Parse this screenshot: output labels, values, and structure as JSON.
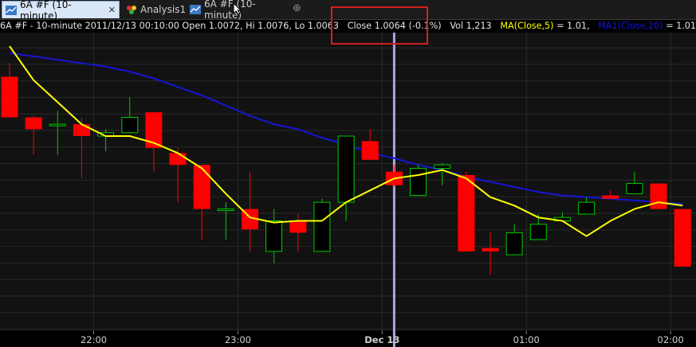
{
  "tabs": [
    {
      "label": "6A #F (10-minute)",
      "icon": "chart-icon",
      "active": true
    },
    {
      "label": "Analysis1",
      "icon": "analysis-icon",
      "active": false
    },
    {
      "label": "6A #F (10-minute)",
      "icon": "chart-icon",
      "active": false
    }
  ],
  "tab_close_symbol": "✕",
  "add_tab_symbol": "⊕",
  "info": {
    "symbol_text": "6A #F - 10-minute 2011/12/13 00:10:00 Open 1.0072, Hi 1.0076, Lo 1.0063",
    "close_text": "Close 1.0064 (-0.1%)",
    "vol_text": "Vol 1,213",
    "ma5_label": "MA(Close,5)",
    "ma5_value": "= 1.01,",
    "ma20_label": "MA1(Close,20)",
    "ma20_value": "= 1.01",
    "ma5_color": "#ffff00",
    "ma20_color": "#1515d6"
  },
  "chart_data": {
    "type": "candlestick",
    "x_tick_labels": [
      "22:00",
      "23:00",
      "Dec 13",
      "01:00",
      "02:00"
    ],
    "x_tick_slots": [
      3.5,
      9.5,
      15.5,
      21.5,
      27.5
    ],
    "crosshair_slot": 16,
    "up_color": "#00cc00",
    "down_color": "#ff0000",
    "ylim": [
      0.9978,
      1.0154
    ],
    "grid": true,
    "candles": [
      {
        "o": 1.0128,
        "h": 1.0136,
        "l": 1.0105,
        "c": 1.0104
      },
      {
        "o": 1.0104,
        "h": 1.0105,
        "l": 1.0082,
        "c": 1.0097
      },
      {
        "o": 1.01,
        "h": 1.0108,
        "l": 1.0082,
        "c": 1.01
      },
      {
        "o": 1.01,
        "h": 1.0104,
        "l": 1.0068,
        "c": 1.0093
      },
      {
        "o": 1.0093,
        "h": 1.0097,
        "l": 1.0084,
        "c": 1.0095
      },
      {
        "o": 1.0095,
        "h": 1.0116,
        "l": 1.0095,
        "c": 1.0104
      },
      {
        "o": 1.0107,
        "h": 1.0107,
        "l": 1.0072,
        "c": 1.0086
      },
      {
        "o": 1.0083,
        "h": 1.0086,
        "l": 1.0054,
        "c": 1.0076
      },
      {
        "o": 1.0076,
        "h": 1.0076,
        "l": 1.0032,
        "c": 1.005
      },
      {
        "o": 1.005,
        "h": 1.0054,
        "l": 1.0032,
        "c": 1.005
      },
      {
        "o": 1.005,
        "h": 1.0072,
        "l": 1.0025,
        "c": 1.0038
      },
      {
        "o": 1.0025,
        "h": 1.005,
        "l": 1.0018,
        "c": 1.0043
      },
      {
        "o": 1.0043,
        "h": 1.0047,
        "l": 1.0025,
        "c": 1.0036
      },
      {
        "o": 1.0025,
        "h": 1.0056,
        "l": 1.0025,
        "c": 1.0054
      },
      {
        "o": 1.0054,
        "h": 1.0093,
        "l": 1.0043,
        "c": 1.0093
      },
      {
        "o": 1.009,
        "h": 1.0097,
        "l": 1.0079,
        "c": 1.0079
      },
      {
        "o": 1.0072,
        "h": 1.0076,
        "l": 1.0063,
        "c": 1.0064
      },
      {
        "o": 1.0058,
        "h": 1.0076,
        "l": 1.0058,
        "c": 1.0074
      },
      {
        "o": 1.0074,
        "h": 1.0077,
        "l": 1.0064,
        "c": 1.0076
      },
      {
        "o": 1.007,
        "h": 1.0072,
        "l": 1.0026,
        "c": 1.0025
      },
      {
        "o": 1.0027,
        "h": 1.0036,
        "l": 1.0011,
        "c": 1.0025
      },
      {
        "o": 1.0023,
        "h": 1.0041,
        "l": 1.0023,
        "c": 1.0036
      },
      {
        "o": 1.0032,
        "h": 1.0047,
        "l": 1.0032,
        "c": 1.0041
      },
      {
        "o": 1.0043,
        "h": 1.0048,
        "l": 1.0043,
        "c": 1.0045
      },
      {
        "o": 1.0047,
        "h": 1.0057,
        "l": 1.0047,
        "c": 1.0054
      },
      {
        "o": 1.0058,
        "h": 1.0061,
        "l": 1.0056,
        "c": 1.0056
      },
      {
        "o": 1.0059,
        "h": 1.0072,
        "l": 1.0059,
        "c": 1.0065
      },
      {
        "o": 1.0065,
        "h": 1.0065,
        "l": 1.005,
        "c": 1.005
      },
      {
        "o": 1.005,
        "h": 1.005,
        "l": 1.0016,
        "c": 1.0016
      }
    ],
    "ma5": [
      1.0146,
      1.0126,
      1.0113,
      1.01,
      1.0093,
      1.0093,
      1.0089,
      1.0083,
      1.0074,
      1.0059,
      1.0045,
      1.0042,
      1.0043,
      1.0043,
      1.0054,
      1.0061,
      1.0068,
      1.007,
      1.0073,
      1.0068,
      1.0057,
      1.0052,
      1.0045,
      1.0043,
      1.0034,
      1.0043,
      1.005,
      1.0054,
      1.0052
    ],
    "ma20": [
      1.0142,
      1.014,
      1.0138,
      1.0136,
      1.0134,
      1.0131,
      1.0127,
      1.0122,
      1.0117,
      1.0111,
      1.0105,
      1.01,
      1.0097,
      1.0092,
      1.0088,
      1.0083,
      1.008,
      1.0076,
      1.0073,
      1.0069,
      1.0066,
      1.0063,
      1.006,
      1.0058,
      1.0057,
      1.0056,
      1.0055,
      1.0054,
      1.0053
    ]
  }
}
